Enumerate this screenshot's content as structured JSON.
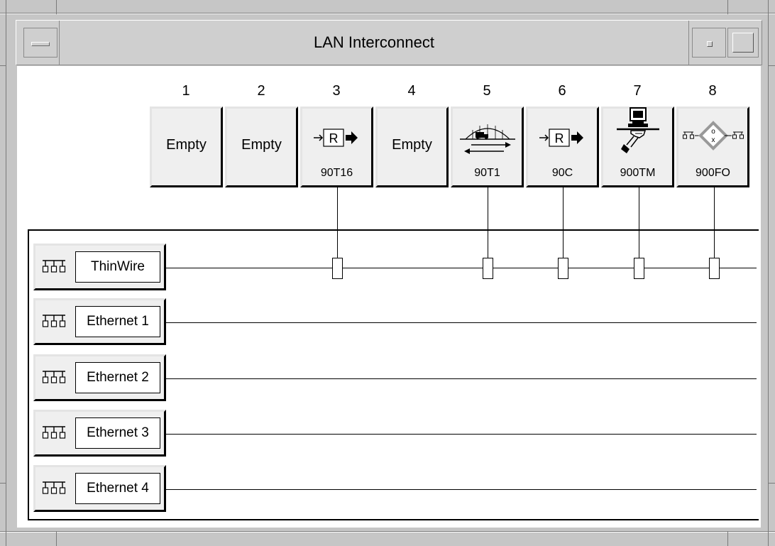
{
  "window": {
    "title": "LAN Interconnect"
  },
  "slots": [
    {
      "number": "1",
      "label": "Empty",
      "module": "",
      "icon": ""
    },
    {
      "number": "2",
      "label": "Empty",
      "module": "",
      "icon": ""
    },
    {
      "number": "3",
      "label": "",
      "module": "90T16",
      "icon": "router-icon",
      "icon_text": "R"
    },
    {
      "number": "4",
      "label": "Empty",
      "module": "",
      "icon": ""
    },
    {
      "number": "5",
      "label": "",
      "module": "90T1",
      "icon": "bridge-icon"
    },
    {
      "number": "6",
      "label": "",
      "module": "90C",
      "icon": "router-icon",
      "icon_text": "R"
    },
    {
      "number": "7",
      "label": "",
      "module": "900TM",
      "icon": "terminal-server-icon"
    },
    {
      "number": "8",
      "label": "",
      "module": "900FO",
      "icon": "fiber-optic-icon",
      "icon_text": "o x"
    }
  ],
  "buses": [
    {
      "label": "ThinWire",
      "icon": "network-icon",
      "connected_slots": [
        "3",
        "5",
        "6",
        "7",
        "8"
      ]
    },
    {
      "label": "Ethernet 1",
      "icon": "network-icon",
      "connected_slots": []
    },
    {
      "label": "Ethernet 2",
      "icon": "network-icon",
      "connected_slots": []
    },
    {
      "label": "Ethernet 3",
      "icon": "network-icon",
      "connected_slots": []
    },
    {
      "label": "Ethernet 4",
      "icon": "network-icon",
      "connected_slots": []
    }
  ]
}
